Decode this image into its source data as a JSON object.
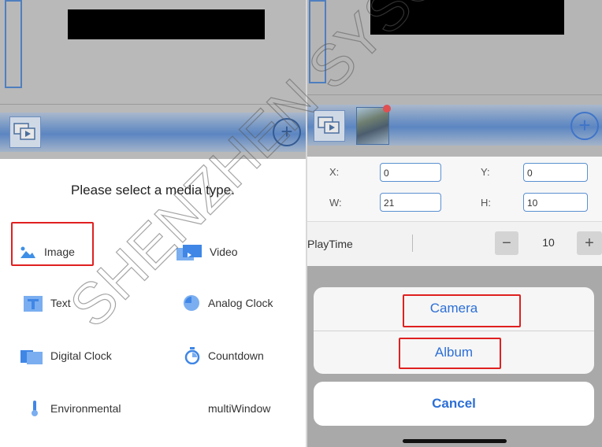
{
  "left": {
    "sheet_title": "Please select a media type.",
    "media_types": [
      {
        "label": "Image",
        "icon": "image-icon"
      },
      {
        "label": "Video",
        "icon": "video-icon"
      },
      {
        "label": "Text",
        "icon": "text-icon"
      },
      {
        "label": "Analog Clock",
        "icon": "analog-clock-icon"
      },
      {
        "label": "Digital Clock",
        "icon": "digital-clock-icon"
      },
      {
        "label": "Countdown",
        "icon": "countdown-icon"
      },
      {
        "label": "Environmental",
        "icon": "thermometer-icon"
      },
      {
        "label": "multiWindow",
        "icon": "multiwindow-icon"
      }
    ],
    "highlighted": "Image"
  },
  "right": {
    "x_label": "X:",
    "x_value": "0",
    "y_label": "Y:",
    "y_value": "0",
    "w_label": "W:",
    "w_value": "21",
    "h_label": "H:",
    "h_value": "10",
    "playtime_label": "PlayTime",
    "playtime_value": "10",
    "minus": "−",
    "plus": "+",
    "actions": {
      "camera": "Camera",
      "album": "Album",
      "cancel": "Cancel"
    }
  },
  "colors": {
    "accent_blue": "#2c6fd6",
    "highlight_red": "#e02020",
    "dim_overlay": "#b9b9b9"
  },
  "watermark": "SHENZHEN SYSOLUTION"
}
